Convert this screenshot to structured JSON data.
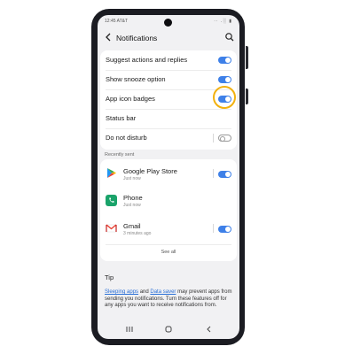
{
  "status_bar": {
    "time": "12:45 AT&T",
    "icons": "·· .░ ▮"
  },
  "header": {
    "title": "Notifications"
  },
  "settings": [
    {
      "label": "Suggest actions and replies",
      "state": "on"
    },
    {
      "label": "Show snooze option",
      "state": "on"
    },
    {
      "label": "App icon badges",
      "state": "on"
    },
    {
      "label": "Status bar",
      "state": "none"
    },
    {
      "label": "Do not disturb",
      "state": "off"
    }
  ],
  "recent": {
    "section_label": "Recently sent",
    "apps": [
      {
        "name": "Google Play Store",
        "time": "Just now",
        "state": "on",
        "icon": "play-store-icon"
      },
      {
        "name": "Phone",
        "time": "Just now",
        "state": "none",
        "icon": "phone-icon"
      },
      {
        "name": "Gmail",
        "time": "3 minutes ago",
        "state": "on",
        "icon": "gmail-icon"
      }
    ],
    "see_all": "See all"
  },
  "tip": {
    "title": "Tip",
    "link1": "Sleeping apps",
    "and": "and",
    "link2": "Data saver",
    "rest": "may prevent apps from sending you notifications. Turn these features off for any apps you want to receive notifications from."
  },
  "colors": {
    "toggle_on": "#3e80e8",
    "highlight": "#f2b10f",
    "phone_body": "#1b1c22"
  }
}
